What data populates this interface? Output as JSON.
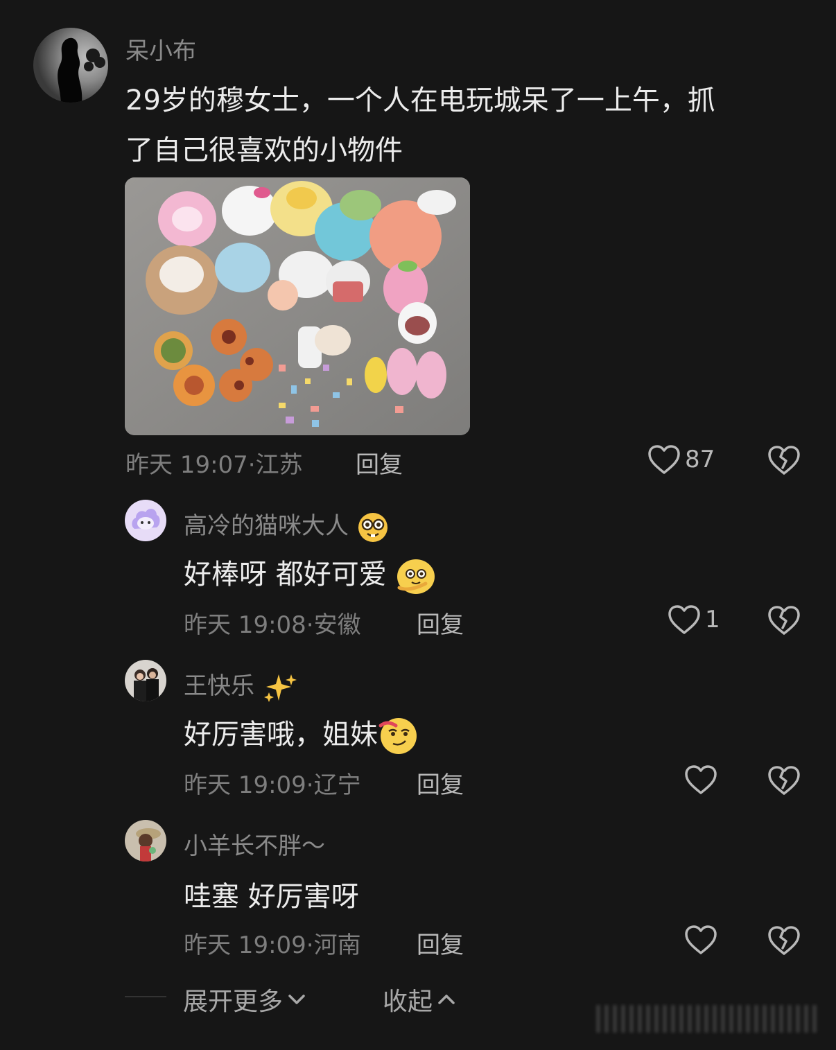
{
  "post": {
    "author": "呆小布",
    "text_line1": "29岁的穆女士，一个人在电玩城呆了一上午，抓",
    "text_line2": "了自己很喜欢的小物件",
    "time": "昨天 19:07·江苏",
    "reply_label": "回复",
    "likes": "87"
  },
  "replies": [
    {
      "author": "高冷的猫咪大人",
      "author_emoji": "nerd-face-icon",
      "text": "好棒呀 都好可爱",
      "text_emoji": "shy-face-icon",
      "time": "昨天 19:08·安徽",
      "reply_label": "回复",
      "likes": "1"
    },
    {
      "author": "王快乐",
      "author_emoji": "sparkles-icon",
      "text": "好厉害哦，姐妹",
      "text_emoji": "smug-face-icon",
      "time": "昨天 19:09·辽宁",
      "reply_label": "回复",
      "likes": ""
    },
    {
      "author": "小羊长不胖～",
      "text": "哇塞 好厉害呀",
      "time": "昨天 19:09·河南",
      "reply_label": "回复",
      "likes": ""
    }
  ],
  "footer": {
    "expand_label": "展开更多",
    "collapse_label": "收起"
  },
  "colors": {
    "background": "#161616",
    "name": "#8a8a8a",
    "text": "#ececec",
    "meta": "#7e7e7e"
  }
}
